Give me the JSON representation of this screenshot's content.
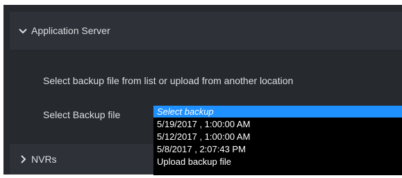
{
  "application_server": {
    "title": "Application Server",
    "expanded": true,
    "hint": "Select backup file from list or upload from another location",
    "backup_label": "Select Backup file",
    "backup_select": {
      "selected": "Select backup",
      "options": [
        "Select backup",
        "5/19/2017 , 1:00:00 AM",
        "5/12/2017 , 1:00:00 AM",
        "5/8/2017 , 2:07:43 PM",
        "Upload backup file"
      ]
    }
  },
  "nvrs": {
    "title": "NVRs",
    "expanded": false
  },
  "colors": {
    "panel_bg": "#26292e",
    "header_bg": "#2e3238",
    "text": "#dcdfe3",
    "dropdown_bg": "#000000",
    "selection": "#1e90ff"
  }
}
